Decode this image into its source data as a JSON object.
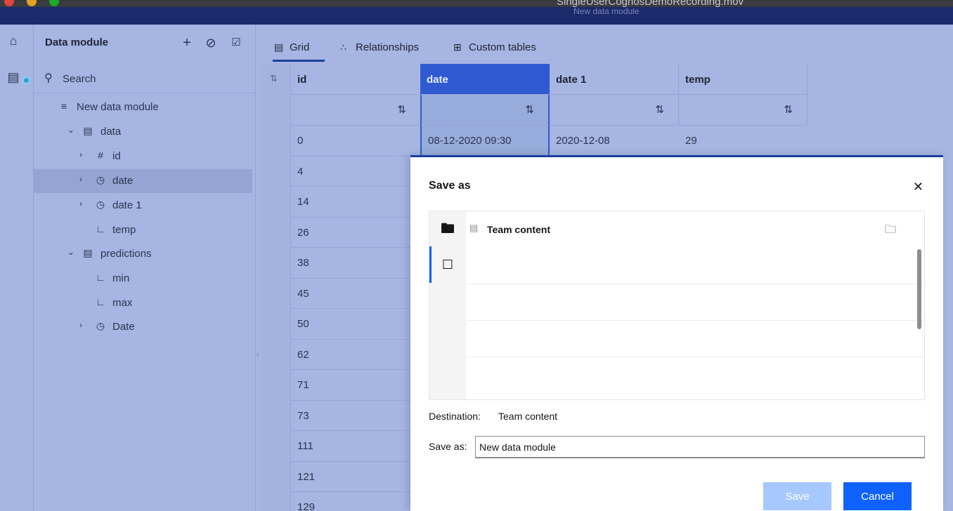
{
  "window": {
    "title": "SingleUserCognosDemoRecording.mov",
    "subtitle": "New data module"
  },
  "sources_panel": {
    "title": "Data module",
    "search_placeholder": "Search",
    "tree": [
      {
        "label": "New data module",
        "icon": "data-module-icon",
        "level": 0
      },
      {
        "label": "data",
        "icon": "table-icon",
        "level": 1,
        "expanded": true
      },
      {
        "label": "id",
        "icon": "hash-icon",
        "level": 2,
        "collapsed": true
      },
      {
        "label": "date",
        "icon": "clock-icon",
        "level": 2,
        "collapsed": true,
        "selected": true
      },
      {
        "label": "date 1",
        "icon": "clock-icon",
        "level": 2,
        "collapsed": true
      },
      {
        "label": "temp",
        "icon": "measure-icon",
        "level": 2
      },
      {
        "label": "predictions",
        "icon": "table-icon",
        "level": 1,
        "expanded": true
      },
      {
        "label": "min",
        "icon": "measure-icon",
        "level": 2
      },
      {
        "label": "max",
        "icon": "measure-icon",
        "level": 2
      },
      {
        "label": "Date",
        "icon": "clock-icon",
        "level": 2,
        "collapsed": true
      }
    ]
  },
  "tabs": [
    {
      "label": "Grid",
      "icon": "grid-icon",
      "active": true
    },
    {
      "label": "Relationships",
      "icon": "relationships-icon"
    },
    {
      "label": "Custom tables",
      "icon": "custom-table-icon"
    }
  ],
  "grid": {
    "columns": [
      "id",
      "date",
      "date 1",
      "temp"
    ],
    "rows": [
      {
        "id": "0",
        "date": "08-12-2020 09:30",
        "date1": "2020-12-08",
        "temp": "29"
      },
      {
        "id": "4"
      },
      {
        "id": "14"
      },
      {
        "id": "26"
      },
      {
        "id": "38"
      },
      {
        "id": "45"
      },
      {
        "id": "50"
      },
      {
        "id": "62"
      },
      {
        "id": "71"
      },
      {
        "id": "73"
      },
      {
        "id": "111"
      },
      {
        "id": "121"
      },
      {
        "id": "129"
      }
    ]
  },
  "dialog": {
    "title": "Save as",
    "breadcrumb": "Team content",
    "destination_label": "Destination:",
    "destination_value": "Team content",
    "saveas_label": "Save as:",
    "saveas_value": "New data module",
    "save_button": "Save",
    "cancel_button": "Cancel"
  },
  "colors": {
    "overlay": "#a6b5e2",
    "appbar": "#1b2a6b",
    "primary_button": "#0f62fe",
    "disabled_button": "#a6c8ff",
    "selected_column": "#2f5ad1"
  }
}
